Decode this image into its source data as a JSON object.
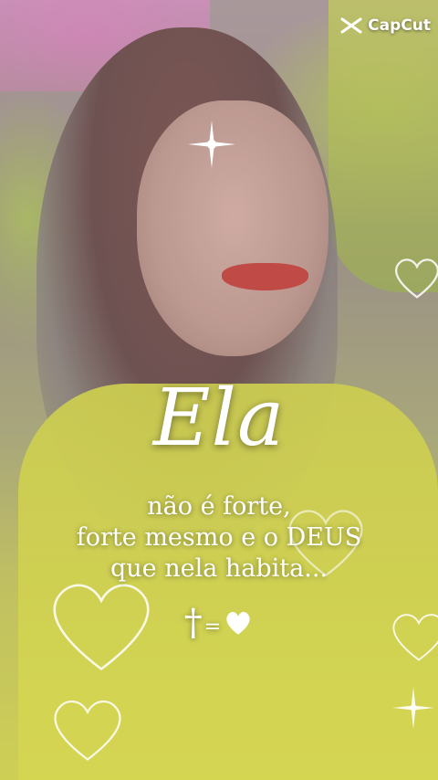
{
  "watermark": {
    "label": "CapCut",
    "icon": "capcut-logo-icon"
  },
  "overlay": {
    "title": "Ela",
    "lines": [
      "não é forte,",
      "forte mesmo e o DEUS",
      "que nela habita..."
    ],
    "symbols": {
      "cross": "†",
      "equals": "=",
      "heart": "♥"
    }
  },
  "colors": {
    "text": "#ffffff",
    "heart_outline": "#ffffff",
    "shirt": "#c7c93e",
    "lips": "#b8322c"
  }
}
